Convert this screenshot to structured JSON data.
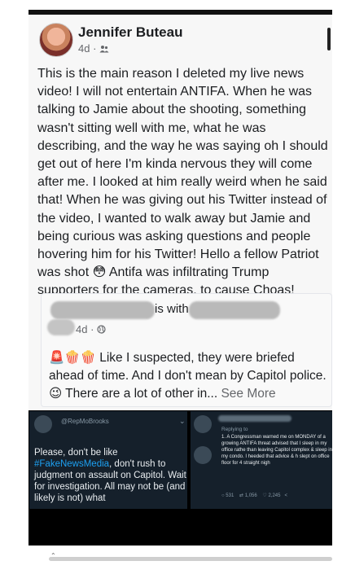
{
  "post": {
    "author": "Jennifer Buteau",
    "time": "4d",
    "separator": "·",
    "audience_icon": "friends-icon",
    "text": "This is the main reason I deleted my live news video! I will not entertain ANTIFA. When he was talking to Jamie about the shooting, something wasn't sitting well with me, what he was describing, and the way he was saying oh I should get out of here I'm kinda nervous they will come after me. I looked at him really weird when he said that! When he was giving out his Twitter instead of the video, I wanted to walk away but Jamie and being curious was asking questions and people hovering him for his Twitter! Hello a fellow Patriot was shot 😳 Antifa was infiltrating Trump supporters for the cameras, to cause Choas!"
  },
  "shared": {
    "is_with": "is with",
    "time": "4d",
    "separator": "·",
    "audience_icon": "globe-icon",
    "emojis": "🚨🍿🍿",
    "text": "Like I suspected, they were briefed ahead of time. And I don't mean by Capitol police. 😉 There are a lot of other in...",
    "see_more": "See More"
  },
  "tweet_left": {
    "handle": "@RepMoBrooks",
    "text_before": "Please, don't be like ",
    "hashtag": "#FakeNewsMedia",
    "text_after": ", don't rush to judgment on assault on Capitol. Wait for investigation. All may not be (and likely is not) what"
  },
  "tweet_right": {
    "replying": "Replying to",
    "text": "1. A Congressman warned me on MONDAY of a growing ANTIFA threat advised that I sleep in my office rathe than leaving Capitol complex & sleep in my condo. I heeded that advice & h slept on office floor for 4 straight nigh",
    "replies": "531",
    "retweets": "1,056",
    "likes": "2,245"
  }
}
